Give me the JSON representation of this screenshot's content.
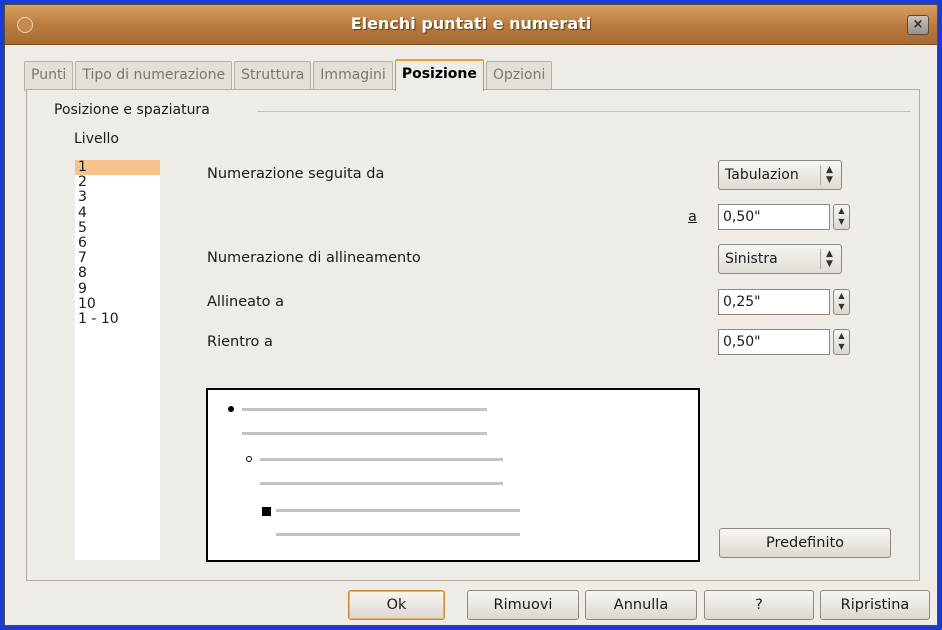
{
  "window": {
    "title": "Elenchi puntati e numerati",
    "close_glyph": "×"
  },
  "tabs": [
    {
      "label": "Punti",
      "active": false
    },
    {
      "label": "Tipo di numerazione",
      "active": false
    },
    {
      "label": "Struttura",
      "active": false
    },
    {
      "label": "Immagini",
      "active": false
    },
    {
      "label": "Posizione",
      "active": true
    },
    {
      "label": "Opzioni",
      "active": false
    }
  ],
  "section": {
    "title": "Posizione e spaziatura"
  },
  "levels": {
    "label": "Livello",
    "items": [
      "1",
      "2",
      "3",
      "4",
      "5",
      "6",
      "7",
      "8",
      "9",
      "10",
      "1 - 10"
    ],
    "selected": "1"
  },
  "fields": {
    "numbering_followed_by": {
      "label": "Numerazione seguita da",
      "value": "Tabulazion"
    },
    "tab_at": {
      "label": "a",
      "value": "0,50\""
    },
    "numbering_alignment": {
      "label": "Numerazione di allineamento",
      "value": "Sinistra"
    },
    "aligned_at": {
      "label": "Allineato a",
      "value": "0,25\""
    },
    "indent_at": {
      "label": "Rientro a",
      "value": "0,50\""
    }
  },
  "buttons": {
    "default": "Predefinito",
    "ok": "Ok",
    "remove": "Rimuovi",
    "cancel": "Annulla",
    "help": "?",
    "reset": "Ripristina"
  },
  "icons": {
    "window_menu": "circle-icon",
    "close": "close-icon",
    "spin": "spin-arrows-icon",
    "select": "dropdown-arrows-icon"
  },
  "colors": {
    "titlebar": "#c88a4c",
    "selected_level": "#f6c48a",
    "active_tab_accent": "#e9a040",
    "desktop": "#1a3bd0"
  }
}
